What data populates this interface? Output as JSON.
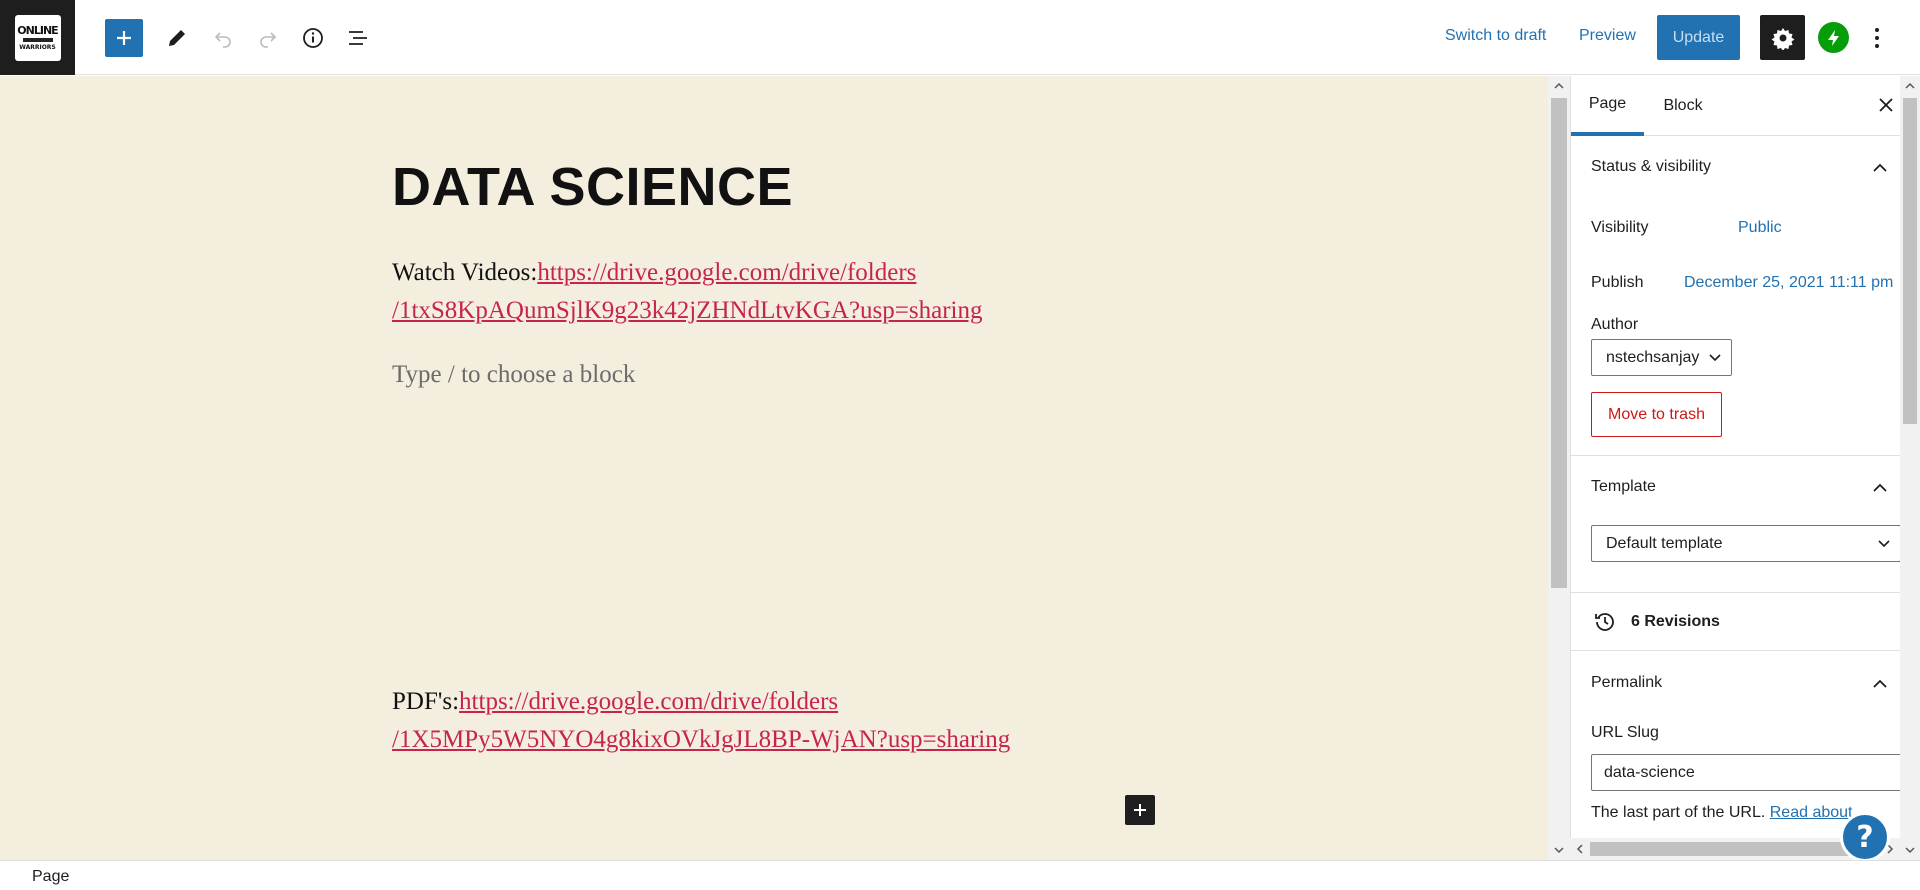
{
  "topbar": {
    "logo_line1": "ONLINE",
    "logo_line2": "WARRIORS",
    "switch_to_draft": "Switch to draft",
    "preview": "Preview",
    "update": "Update",
    "icons": {
      "add": "plus-icon",
      "edit": "pencil-icon",
      "undo": "undo-icon",
      "redo": "redo-icon",
      "info": "info-icon",
      "list": "list-view-icon",
      "settings": "gear-icon",
      "jetpack": "jetpack-icon",
      "more": "more-vertical-icon"
    },
    "colors": {
      "accent": "#2271b1",
      "jetpack": "#069e08"
    }
  },
  "editor": {
    "title": "DATA SCIENCE",
    "watch_prefix": "Watch Videos:",
    "watch_link_line1": "https://drive.google.com/drive/folders",
    "watch_link_line2": "/1txS8KpAQumSjlK9g23k42jZHNdLtvKGA?usp=sharing",
    "block_placeholder": "Type / to choose a block",
    "pdf_prefix": "PDF's:",
    "pdf_link_line1": "https://drive.google.com/drive/folders",
    "pdf_link_line2": "/1X5MPy5W5NYO4g8kixOVkJgJL8BP-WjAN?usp=sharing",
    "colors": {
      "background": "#f4eedf",
      "link": "#c6244f"
    }
  },
  "sidebar": {
    "tabs": [
      {
        "label": "Page",
        "active": true
      },
      {
        "label": "Block",
        "active": false
      }
    ],
    "status_visibility": {
      "heading": "Status & visibility",
      "visibility_label": "Visibility",
      "visibility_value": "Public",
      "publish_label": "Publish",
      "publish_value": "December 25, 2021 11:11 pm",
      "author_label": "Author",
      "author_value": "nstechsanjay",
      "trash_button": "Move to trash"
    },
    "template": {
      "heading": "Template",
      "selected": "Default template"
    },
    "revisions": {
      "label": "6 Revisions"
    },
    "permalink": {
      "heading": "Permalink",
      "slug_label": "URL Slug",
      "slug_value": "data-science",
      "help_text": "The last part of the URL. ",
      "help_link": "Read about"
    }
  },
  "help_button": "?",
  "footer": {
    "breadcrumb": "Page"
  }
}
